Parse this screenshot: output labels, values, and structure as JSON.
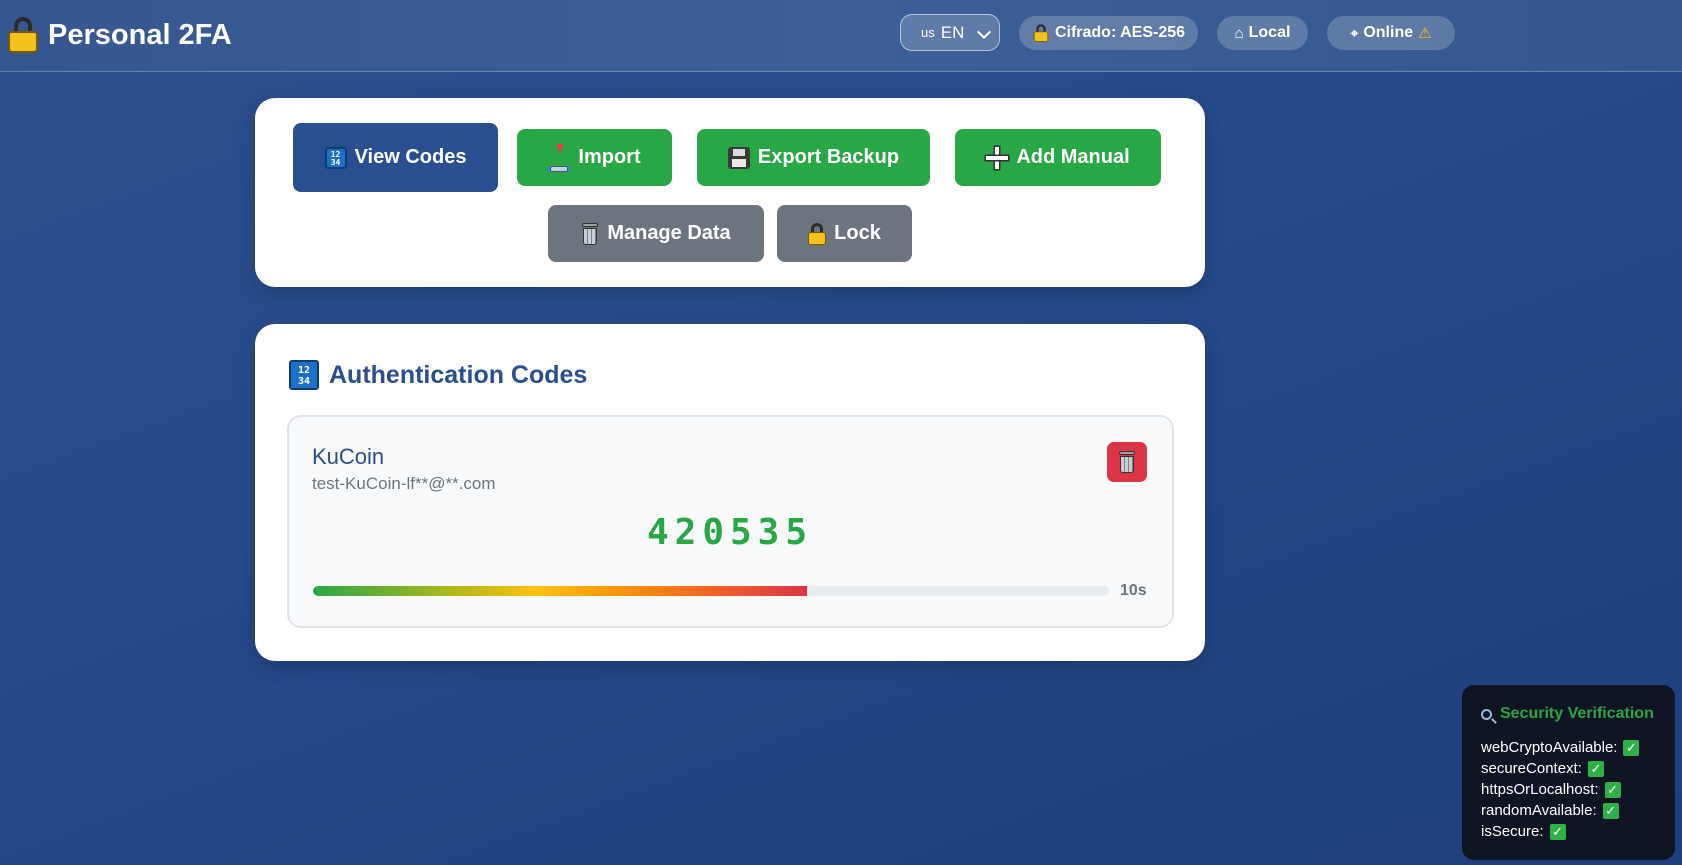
{
  "header": {
    "title": "Personal 2FA",
    "language": {
      "flag": "us",
      "label": "EN"
    },
    "pills": [
      {
        "icon": "lock-icon",
        "label": "Cifrado: AES-256"
      },
      {
        "icon": "house-icon",
        "label": "Local"
      },
      {
        "icon": "satellite-icon",
        "label": "Online",
        "status_icon": "warning-icon"
      }
    ]
  },
  "toolbar": {
    "view_codes": "View Codes",
    "import": "Import",
    "export_backup": "Export Backup",
    "add_manual": "Add Manual",
    "manage_data": "Manage Data",
    "lock": "Lock"
  },
  "codes_section": {
    "title": "Authentication Codes",
    "items": [
      {
        "service": "KuCoin",
        "account": "test-KuCoin-lf**@**.com",
        "code": "420535",
        "remaining_fraction": 0.62,
        "timer": "10s"
      }
    ]
  },
  "security_panel": {
    "title": "Security Verification",
    "checks": [
      {
        "label": "webCryptoAvailable:",
        "ok": "✓"
      },
      {
        "label": "secureContext:",
        "ok": "✓"
      },
      {
        "label": "httpsOrLocalhost:",
        "ok": "✓"
      },
      {
        "label": "randomAvailable:",
        "ok": "✓"
      },
      {
        "label": "isSecure:",
        "ok": "✓"
      }
    ]
  },
  "colors": {
    "primary": "#2a4f91",
    "success": "#28a745",
    "secondary": "#6c757d",
    "danger": "#dc3545"
  }
}
